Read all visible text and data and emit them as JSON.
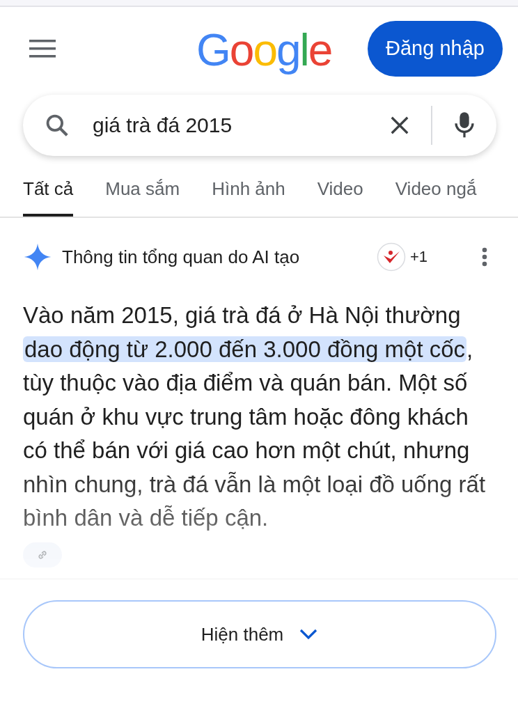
{
  "header": {
    "logo": "Google",
    "sign_in": "Đăng nhập"
  },
  "search": {
    "value": "giá trà đá 2015"
  },
  "tabs": [
    {
      "label": "Tất cả",
      "selected": true
    },
    {
      "label": "Mua sắm",
      "selected": false
    },
    {
      "label": "Hình ảnh",
      "selected": false
    },
    {
      "label": "Video",
      "selected": false
    },
    {
      "label": "Video ngắ",
      "selected": false
    }
  ],
  "ai_overview": {
    "title": "Thông tin tổng quan do AI tạo",
    "sources_count": "+1",
    "text": "Vào năm 2015, giá trà đá ở Hà Nội thường **dao động từ 2.000 đến 3.000 đồng một cốc**, tùy thuộc vào địa điểm và quán bán. Một số quán ở khu vực trung tâm hoặc đông khách có thể bán với giá cao hơn một chút, nhưng nhìn chung, trà đá vẫn là một loại đồ uống rất bình dân và dễ tiếp cận.",
    "show_more": "Hiện thêm"
  }
}
